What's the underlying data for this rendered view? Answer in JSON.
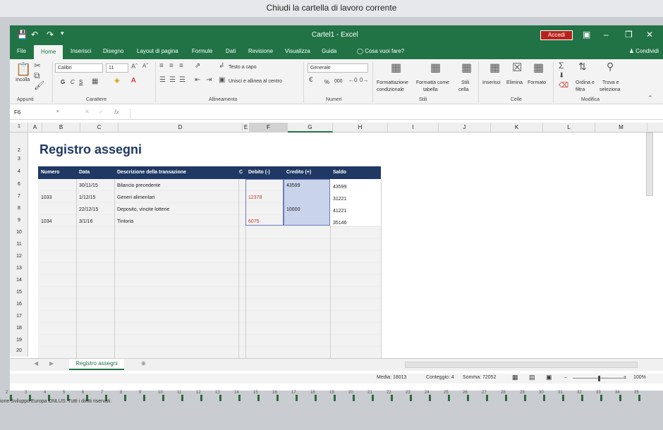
{
  "tooltip": "Chiudi la cartella di lavoro corrente",
  "window": {
    "title": "Cartel1 - Excel",
    "signin": "Accedi"
  },
  "tabs": {
    "items": [
      "File",
      "Home",
      "Inserisci",
      "Disegno",
      "Layout di pagina",
      "Formule",
      "Dati",
      "Revisione",
      "Visualizza",
      "Guida"
    ],
    "search": "Cosa vuoi fare?",
    "share": "Condividi"
  },
  "ribbon": {
    "font_name": "Calibri",
    "font_size": "11",
    "wrap": "Testo a capo",
    "merge": "Unisci e allinea al centro",
    "number_format": "Generale",
    "percent": "%",
    "thousands": "000",
    "cond1": "Formattazione",
    "cond2": "condizionale",
    "fmt1": "Formatta come",
    "fmt2": "tabella",
    "stili1": "Stili",
    "stili2": "cella",
    "insert": "Inserisci",
    "delete": "Elimina",
    "format": "Formato",
    "sort1": "Ordina e",
    "sort2": "filtra",
    "find1": "Trova e",
    "find2": "seleziona",
    "paste": "Incolla",
    "bold": "G",
    "italic": "C",
    "underline": "S",
    "groups": {
      "clipboard": "Appunti",
      "font": "Carattere",
      "align": "Allineamento",
      "number": "Numeri",
      "styles": "Stili",
      "cells": "Celle",
      "edit": "Modifica"
    }
  },
  "formula_bar": {
    "name_box": "F6",
    "fx": "fx",
    "value": ""
  },
  "columns": [
    "A",
    "B",
    "C",
    "D",
    "E",
    "F",
    "G",
    "H",
    "I",
    "J",
    "K",
    "L",
    "M"
  ],
  "rows": [
    "1",
    "2",
    "3",
    "4",
    "6",
    "7",
    "8",
    "9",
    "10",
    "11",
    "12",
    "13",
    "14",
    "15",
    "16",
    "17",
    "18",
    "19",
    "20"
  ],
  "sheet": {
    "title": "Registro assegni",
    "headers": {
      "numero": "Numero",
      "data": "Data",
      "descrizione": "Descrizione della transazione",
      "c": "C",
      "debito": "Debito (-)",
      "credito": "Credito (+)",
      "saldo": "Saldo"
    },
    "rows": [
      {
        "numero": "",
        "data": "30/11/15",
        "descrizione": "Bilancio precedente",
        "debito": "",
        "credito": "43599",
        "saldo": "43599"
      },
      {
        "numero": "1033",
        "data": "1/12/15",
        "descrizione": "Generi alimentari",
        "debito": "12378",
        "credito": "",
        "saldo": "31221"
      },
      {
        "numero": "",
        "data": "22/12/15",
        "descrizione": "Deposito, vincite lotterie",
        "debito": "",
        "credito": "10000",
        "saldo": "41221"
      },
      {
        "numero": "1034",
        "data": "3/1/16",
        "descrizione": "Tintoria",
        "debito": "6075",
        "credito": "",
        "saldo": "35146"
      }
    ]
  },
  "sheet_tab": "Registro assegni",
  "status": {
    "media": "Media: 18013",
    "conteggio": "Conteggio: 4",
    "somma": "Somma: 72052",
    "zoom": "100%"
  },
  "footer": "ione Sviluppo Europa ONLUS. Tutti i diritti riservati.",
  "dock_numbers": [
    "2",
    "3",
    "4",
    "5",
    "6",
    "7",
    "8",
    "9",
    "10",
    "11",
    "12",
    "13",
    "14",
    "15",
    "16",
    "17",
    "18",
    "19",
    "20",
    "21",
    "22",
    "23",
    "24",
    "25",
    "26",
    "27",
    "28",
    "29",
    "30",
    "31",
    "32",
    "33",
    "34",
    "35"
  ],
  "colors": {
    "excel_green": "#217346",
    "table_header": "#1f3864",
    "credit_fill": "#c9d3ea",
    "debit_text": "#c0392b"
  }
}
